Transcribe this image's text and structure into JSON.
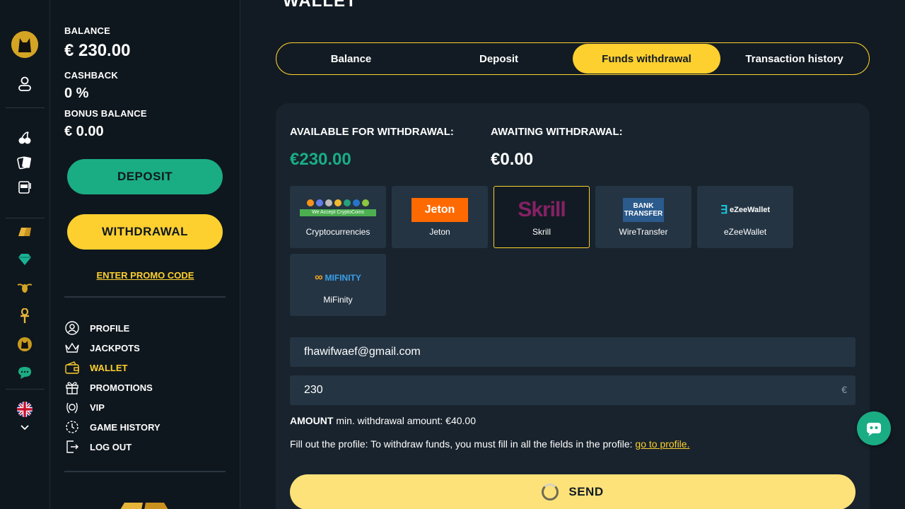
{
  "page": {
    "title": "WALLET"
  },
  "sidebar": {
    "balance_label": "BALANCE",
    "balance_value": "€ 230.00",
    "cashback_label": "CASHBACK",
    "cashback_value": "0 %",
    "bonus_label": "BONUS BALANCE",
    "bonus_value": "€ 0.00",
    "deposit_button": "DEPOSIT",
    "withdrawal_button": "WITHDRAWAL",
    "promo_link": "ENTER PROMO CODE",
    "menu": [
      {
        "label": "PROFILE",
        "icon": "user-icon"
      },
      {
        "label": "JACKPOTS",
        "icon": "crown-icon"
      },
      {
        "label": "WALLET",
        "icon": "wallet-icon",
        "active": true
      },
      {
        "label": "PROMOTIONS",
        "icon": "gift-icon"
      },
      {
        "label": "VIP",
        "icon": "laurel-icon"
      },
      {
        "label": "GAME HISTORY",
        "icon": "history-icon"
      },
      {
        "label": "LOG OUT",
        "icon": "logout-icon"
      }
    ]
  },
  "tabs": [
    {
      "label": "Balance"
    },
    {
      "label": "Deposit"
    },
    {
      "label": "Funds withdrawal",
      "active": true
    },
    {
      "label": "Transaction history"
    }
  ],
  "withdrawal": {
    "available_label": "AVAILABLE FOR WITHDRAWAL:",
    "available_value": "€230.00",
    "awaiting_label": "AWAITING WITHDRAWAL:",
    "awaiting_value": "€0.00",
    "methods": [
      {
        "name": "Cryptocurrencies",
        "logo_text": "We Accept CryptoCoins"
      },
      {
        "name": "Jeton",
        "logo_text": "Jeton"
      },
      {
        "name": "Skrill",
        "logo_text": "Skrill",
        "selected": true
      },
      {
        "name": "WireTransfer",
        "logo_text": "BANK TRANSFER"
      },
      {
        "name": "eZeeWallet",
        "logo_text": "eZeeWallet"
      },
      {
        "name": "MiFinity",
        "logo_text": "MIFINITY"
      }
    ],
    "email_value": "fhawifwaef@gmail.com",
    "amount_value": "230",
    "currency_symbol": "€",
    "amount_label": "AMOUNT",
    "min_text": "min. withdrawal amount: €40.00",
    "profile_note": "Fill out the profile: To withdraw funds, you must fill in all the fields in the profile:",
    "profile_link": "go to profile.",
    "send_button": "SEND"
  },
  "colors": {
    "accent": "#fdd02f",
    "green": "#1aad84",
    "bg": "#121b23",
    "panel": "#18232d",
    "field": "#243443"
  }
}
